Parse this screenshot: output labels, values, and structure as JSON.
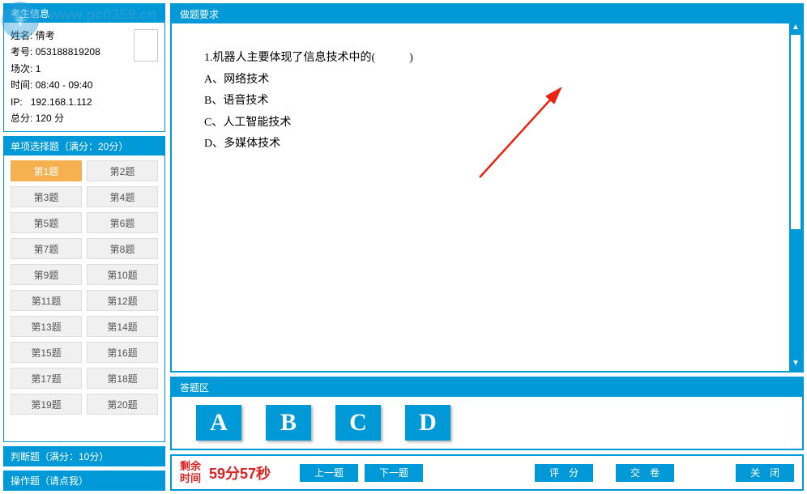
{
  "watermark": "www.pc0359.cn",
  "candidate_panel": {
    "title": "考生信息",
    "name_label": "姓名:",
    "name": "倩考",
    "id_label": "考号:",
    "id": "053188819208",
    "session_label": "场次:",
    "session": "1",
    "time_label": "时间:",
    "time": "08:40 - 09:40",
    "ip_label": "IP:",
    "ip": "192.168.1.112",
    "total_label": "总分:",
    "total": "120 分"
  },
  "single_choice_header": "单项选择题（满分：20分）",
  "questions": [
    "第1题",
    "第2题",
    "第3题",
    "第4题",
    "第5题",
    "第6题",
    "第7题",
    "第8题",
    "第9题",
    "第10题",
    "第11题",
    "第12题",
    "第13题",
    "第14题",
    "第15题",
    "第16题",
    "第17题",
    "第18题",
    "第19题",
    "第20题"
  ],
  "active_question_index": 0,
  "judge_header": "判断题（满分：10分）",
  "operation_header": "操作题（请点我）",
  "question_area": {
    "title": "做题要求",
    "stem": "1.机器人主要体现了信息技术中的(　　　)",
    "options": {
      "A": "A、网络技术",
      "B": "B、语音技术",
      "C": "C、人工智能技术",
      "D": "D、多媒体技术"
    }
  },
  "answer_area_title": "答题区",
  "answer_buttons": [
    "A",
    "B",
    "C",
    "D"
  ],
  "timer": {
    "label": "剩余\n时间",
    "value": "59分57秒"
  },
  "nav": {
    "prev": "上一题",
    "next": "下一题",
    "score": "评　分",
    "submit": "交　卷",
    "close": "关　闭"
  }
}
